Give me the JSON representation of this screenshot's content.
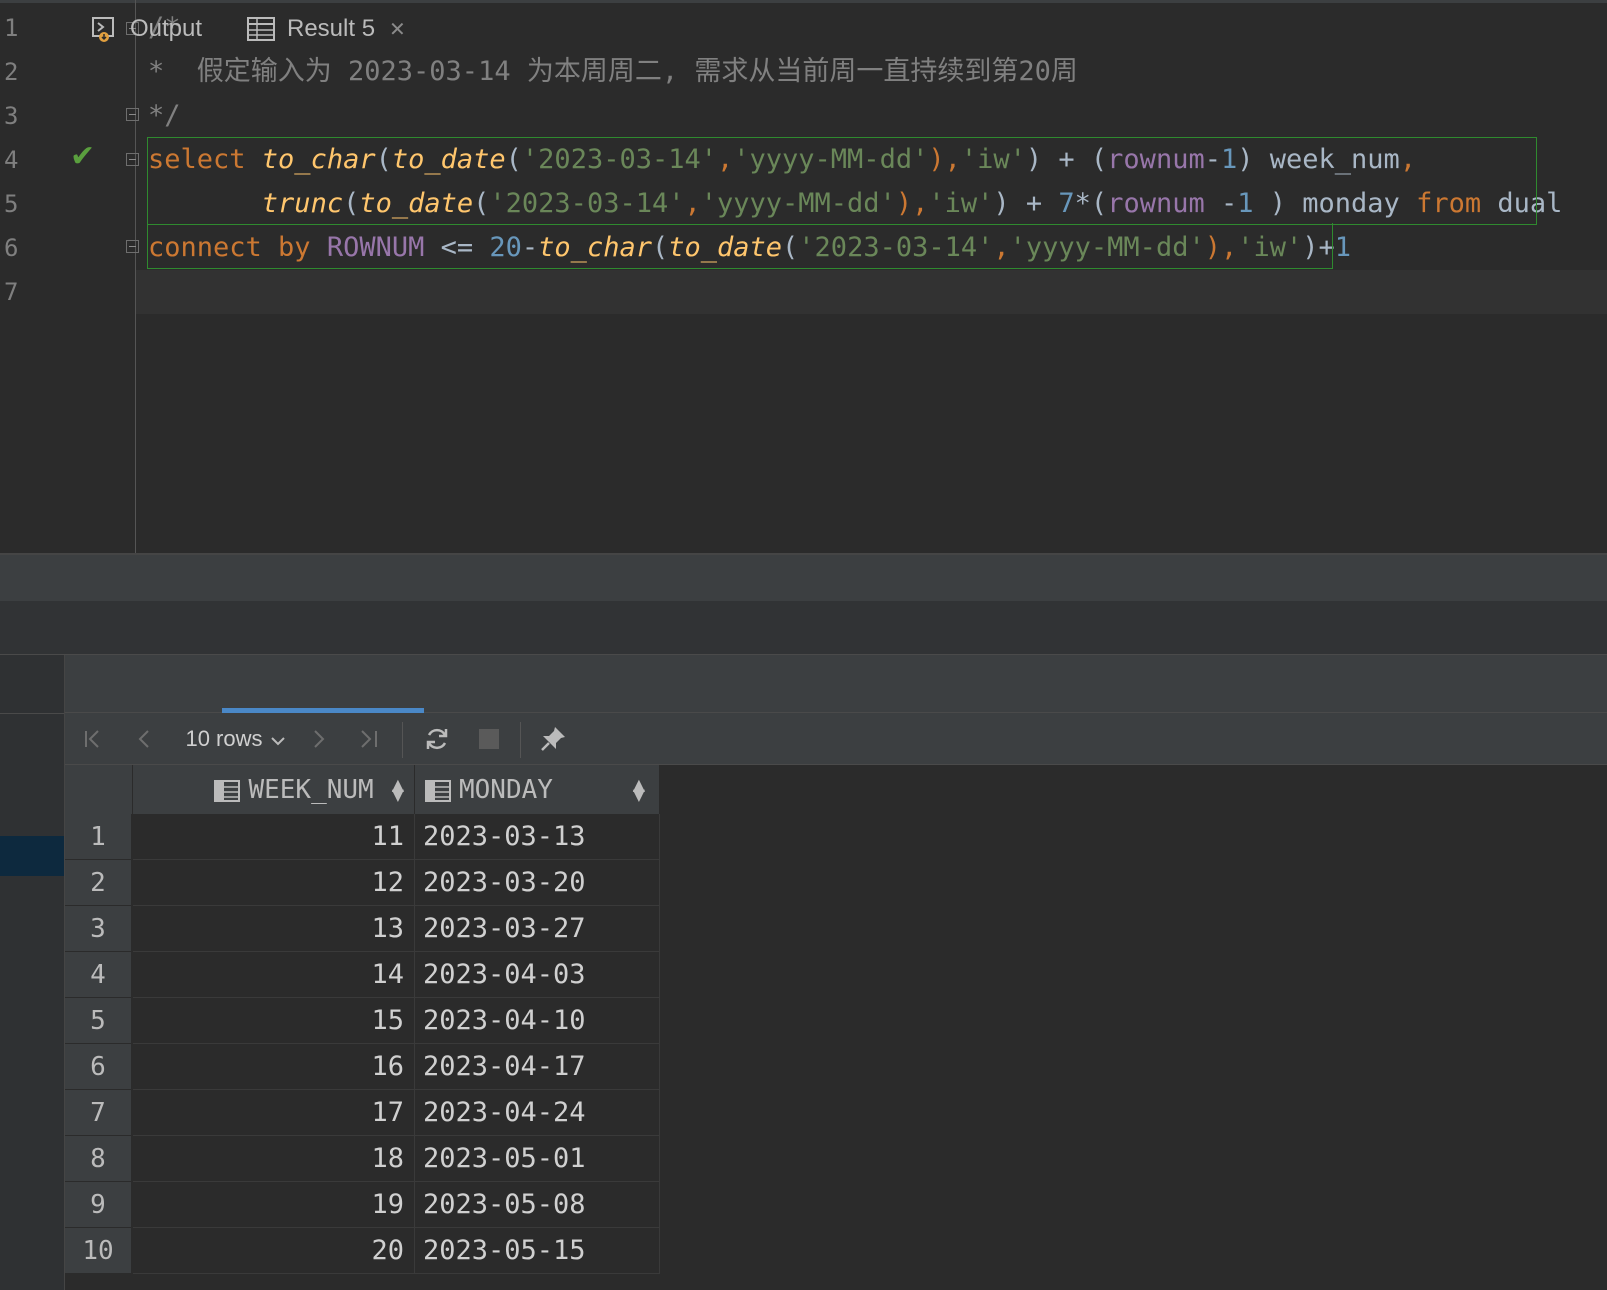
{
  "editor": {
    "line_numbers": [
      "1",
      "2",
      "3",
      "4",
      "5",
      "6",
      "7"
    ],
    "lines": [
      [
        {
          "t": "/*",
          "c": "cm"
        }
      ],
      [
        {
          "t": "*  假定输入为 2023-03-14 为本周周二, 需求从当前周一直持续到第20周",
          "c": "cm"
        }
      ],
      [
        {
          "t": "*/",
          "c": "cm"
        }
      ],
      [
        {
          "t": "select ",
          "c": "kw"
        },
        {
          "t": "to_char",
          "c": "fn"
        },
        {
          "t": "(",
          "c": "op"
        },
        {
          "t": "to_date",
          "c": "fn"
        },
        {
          "t": "(",
          "c": "op"
        },
        {
          "t": "'2023-03-14'",
          "c": "st"
        },
        {
          "t": ",",
          "c": "kw"
        },
        {
          "t": "'yyyy-MM-dd'",
          "c": "st"
        },
        {
          "t": "),",
          "c": "kw"
        },
        {
          "t": "'iw'",
          "c": "st"
        },
        {
          "t": ") + (",
          "c": "op"
        },
        {
          "t": "rownum",
          "c": "ps"
        },
        {
          "t": "-",
          "c": "op"
        },
        {
          "t": "1",
          "c": "nm"
        },
        {
          "t": ") week_num",
          "c": "op"
        },
        {
          "t": ",",
          "c": "kw"
        }
      ],
      [
        {
          "t": "       ",
          "c": "op"
        },
        {
          "t": "trunc",
          "c": "fn"
        },
        {
          "t": "(",
          "c": "op"
        },
        {
          "t": "to_date",
          "c": "fn"
        },
        {
          "t": "(",
          "c": "op"
        },
        {
          "t": "'2023-03-14'",
          "c": "st"
        },
        {
          "t": ",",
          "c": "kw"
        },
        {
          "t": "'yyyy-MM-dd'",
          "c": "st"
        },
        {
          "t": "),",
          "c": "kw"
        },
        {
          "t": "'iw'",
          "c": "st"
        },
        {
          "t": ") + ",
          "c": "op"
        },
        {
          "t": "7",
          "c": "nm"
        },
        {
          "t": "*(",
          "c": "op"
        },
        {
          "t": "rownum",
          "c": "ps"
        },
        {
          "t": " -",
          "c": "op"
        },
        {
          "t": "1",
          "c": "nm"
        },
        {
          "t": " ) monday ",
          "c": "op"
        },
        {
          "t": "from",
          "c": "kw"
        },
        {
          "t": " dual",
          "c": "op"
        }
      ],
      [
        {
          "t": "connect by ",
          "c": "kw"
        },
        {
          "t": "ROWNUM",
          "c": "ps"
        },
        {
          "t": " <= ",
          "c": "op"
        },
        {
          "t": "20",
          "c": "nm"
        },
        {
          "t": "-",
          "c": "op"
        },
        {
          "t": "to_char",
          "c": "fn"
        },
        {
          "t": "(",
          "c": "op"
        },
        {
          "t": "to_date",
          "c": "fn"
        },
        {
          "t": "(",
          "c": "op"
        },
        {
          "t": "'2023-03-14'",
          "c": "st"
        },
        {
          "t": ",",
          "c": "kw"
        },
        {
          "t": "'yyyy-MM-dd'",
          "c": "st"
        },
        {
          "t": "),",
          "c": "kw"
        },
        {
          "t": "'iw'",
          "c": "st"
        },
        {
          "t": ")+",
          "c": "op"
        },
        {
          "t": "1",
          "c": "nm"
        }
      ],
      []
    ],
    "status_icon": "checkmark-icon",
    "colors": {
      "keyword": "#cc7832",
      "function": "#ffc66d",
      "string": "#6a8759",
      "number": "#6897bb",
      "pseudo": "#9876aa",
      "comment": "#808080",
      "text": "#a9b7c6",
      "success": "#5a9f3e",
      "accent": "#4a88c7"
    }
  },
  "tabs": [
    {
      "label": "Output",
      "icon": "output-console-icon"
    },
    {
      "label": "Result 5",
      "icon": "table-icon",
      "close": "✕",
      "active": true
    }
  ],
  "toolbar": {
    "rows_label": "10 rows",
    "icons": [
      "first-page-icon",
      "previous-page-icon",
      "next-page-icon",
      "last-page-icon",
      "refresh-icon",
      "stop-icon",
      "pin-icon"
    ]
  },
  "table": {
    "columns": [
      "WEEK_NUM",
      "MONDAY"
    ],
    "rows": [
      [
        "1",
        "11",
        "2023-03-13"
      ],
      [
        "2",
        "12",
        "2023-03-20"
      ],
      [
        "3",
        "13",
        "2023-03-27"
      ],
      [
        "4",
        "14",
        "2023-04-03"
      ],
      [
        "5",
        "15",
        "2023-04-10"
      ],
      [
        "6",
        "16",
        "2023-04-17"
      ],
      [
        "7",
        "17",
        "2023-04-24"
      ],
      [
        "8",
        "18",
        "2023-05-01"
      ],
      [
        "9",
        "19",
        "2023-05-08"
      ],
      [
        "10",
        "20",
        "2023-05-15"
      ]
    ]
  }
}
